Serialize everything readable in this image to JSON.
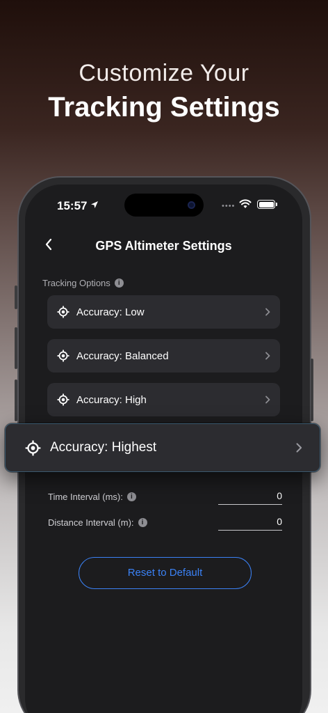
{
  "headline": {
    "line1": "Customize Your",
    "line2": "Tracking Settings"
  },
  "status_bar": {
    "time": "15:57",
    "signal": "••••"
  },
  "nav": {
    "title": "GPS Altimeter Settings"
  },
  "tracking": {
    "section_label": "Tracking Options",
    "options": [
      {
        "label": "Accuracy: Low"
      },
      {
        "label": "Accuracy: Balanced"
      },
      {
        "label": "Accuracy: High"
      }
    ],
    "highlighted": {
      "label": "Accuracy: Highest"
    }
  },
  "fields": {
    "time_interval": {
      "label": "Time Interval (ms):",
      "value": "0"
    },
    "distance_interval": {
      "label": "Distance Interval (m):",
      "value": "0"
    }
  },
  "actions": {
    "reset_label": "Reset to Default"
  },
  "icons": {
    "info": "i"
  },
  "colors": {
    "accent": "#3b82f6",
    "screen_bg": "#1c1c1e",
    "row_bg": "#2c2c30"
  }
}
